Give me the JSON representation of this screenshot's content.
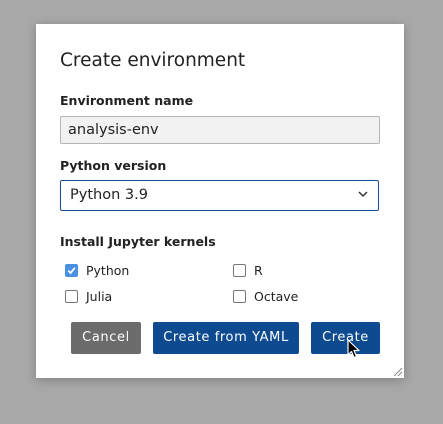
{
  "dialog": {
    "title": "Create environment"
  },
  "name_field": {
    "label": "Environment name",
    "value": "analysis-env"
  },
  "python_version": {
    "label": "Python version",
    "selected": "Python 3.9"
  },
  "kernels": {
    "label": "Install Jupyter kernels",
    "options": [
      {
        "label": "Python",
        "checked": true
      },
      {
        "label": "R",
        "checked": false
      },
      {
        "label": "Julia",
        "checked": false
      },
      {
        "label": "Octave",
        "checked": false
      }
    ]
  },
  "buttons": {
    "cancel": "Cancel",
    "create_from_yaml": "Create from YAML",
    "create": "Create"
  },
  "icons": {
    "select": "chevron-down-icon",
    "check": "checkmark-icon",
    "resize": "resize-grip-icon",
    "cursor": "mouse-pointer-icon"
  },
  "colors": {
    "primary": "#0d4a8f",
    "secondary": "#6c6c6c",
    "checkbox_checked": "#4a90e2",
    "backdrop": "#a9a9a9"
  }
}
